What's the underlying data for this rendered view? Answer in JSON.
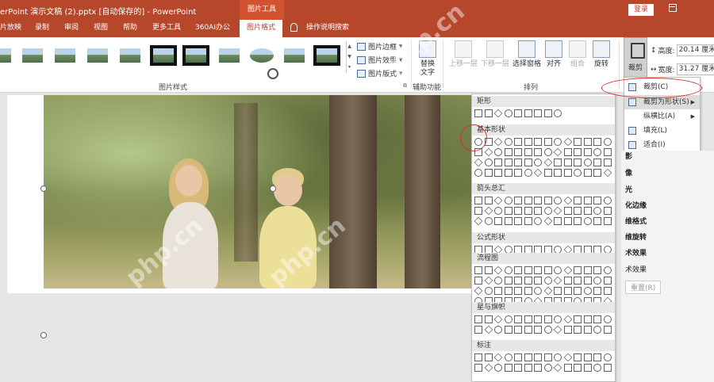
{
  "titlebar": {
    "title": "erPoint 演示文稿 (2).pptx [自动保存的] - PowerPoint",
    "context_tab": "图片工具",
    "login": "登录"
  },
  "tabs": {
    "items": [
      "片放映",
      "录制",
      "审阅",
      "视图",
      "帮助",
      "更多工具",
      "360AI办公",
      "图片格式"
    ],
    "active": "图片格式",
    "search": "操作说明搜索"
  },
  "ribbon": {
    "styles_group_label": "图片样式",
    "border": "图片边框",
    "effects": "图片效果",
    "layout": "图片版式",
    "alt_text": "替换\n文字",
    "accessibility_label": "辅助功能",
    "bring_forward": "上移一层",
    "send_backward": "下移一层",
    "selection_pane": "选择窗格",
    "align": "对齐",
    "group": "组合",
    "rotate": "旋转",
    "arrange_label": "排列",
    "crop": "裁剪",
    "height_label": "高度:",
    "height_value": "20.14 厘米",
    "width_label": "宽度:",
    "width_value": "31.27 厘米"
  },
  "shapes_panel": {
    "sections": [
      "矩形",
      "基本形状",
      "箭头总汇",
      "公式形状",
      "流程图",
      "星与旗帜",
      "标注"
    ]
  },
  "crop_menu": {
    "items": [
      {
        "label": "裁剪(C)",
        "submenu": false
      },
      {
        "label": "裁剪为形状(S)",
        "submenu": true
      },
      {
        "label": "纵横比(A)",
        "submenu": true
      },
      {
        "label": "填充(L)",
        "submenu": false
      },
      {
        "label": "适合(I)",
        "submenu": false
      }
    ]
  },
  "format_pane": {
    "items": [
      "影",
      "像",
      "光",
      "化边缘",
      "维格式",
      "维旋转",
      "术效果",
      "术效果"
    ],
    "reset": "重置(R)"
  },
  "watermark": "php.cn"
}
